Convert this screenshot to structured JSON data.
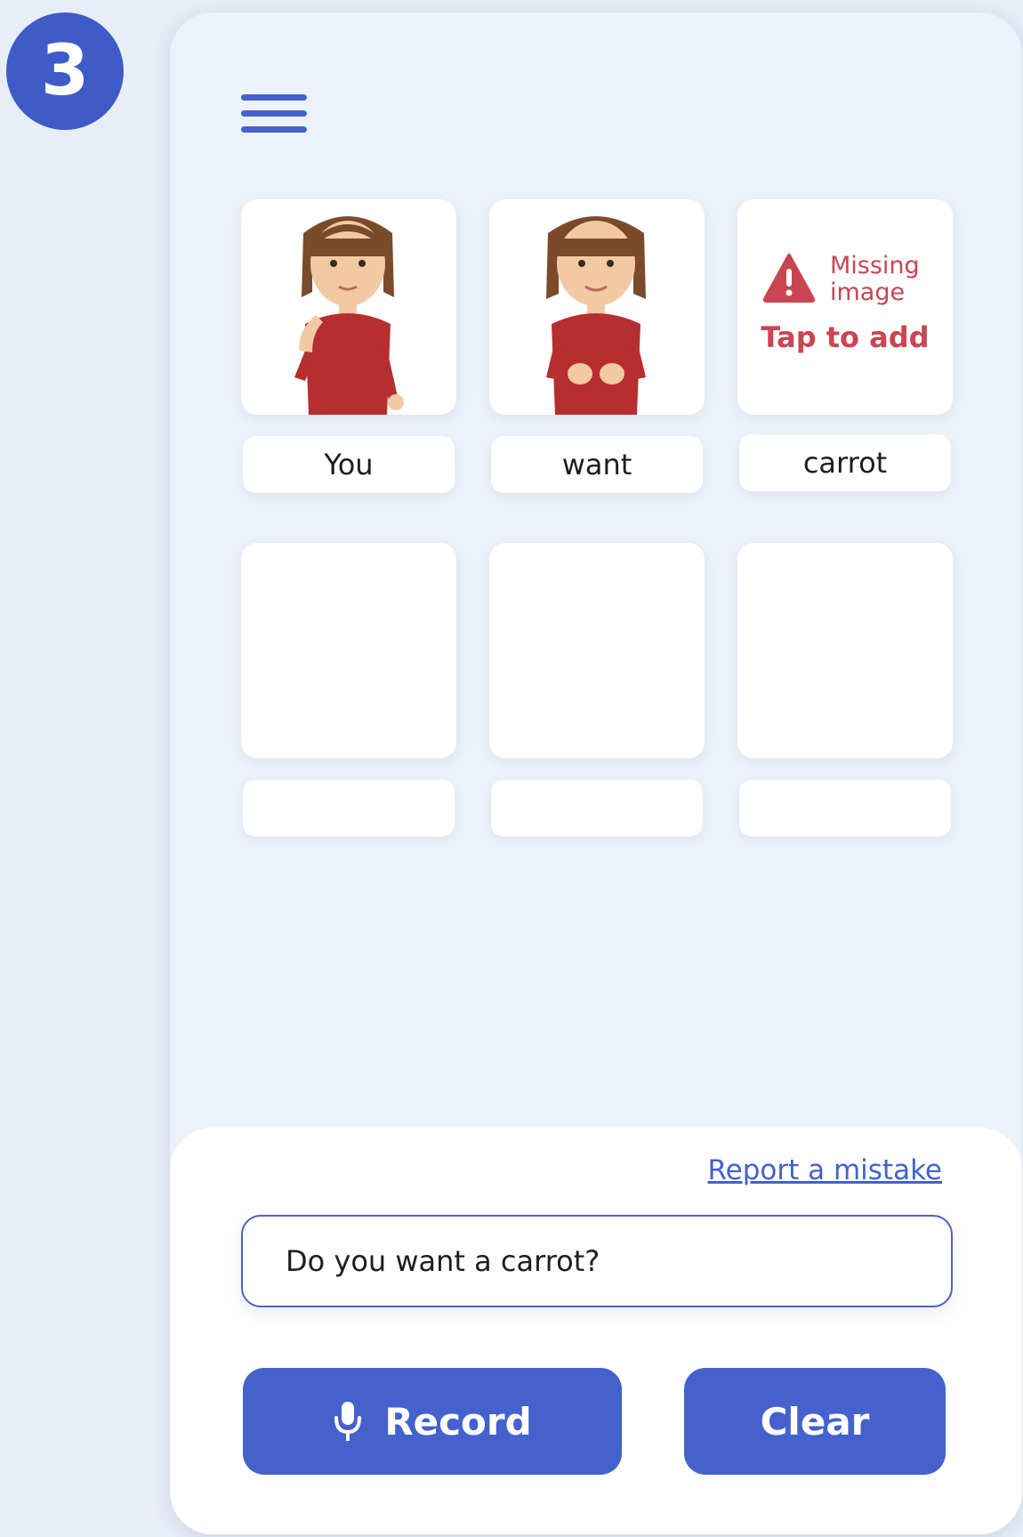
{
  "step_number": "3",
  "cards_row1": [
    {
      "label": "You",
      "image": "child-pointing-you-sign"
    },
    {
      "label": "want",
      "image": "child-want-sign"
    },
    {
      "label": "carrot",
      "image": null,
      "missing_title": "Missing image",
      "missing_action": "Tap to add"
    }
  ],
  "cards_row2": [
    {
      "label": ""
    },
    {
      "label": ""
    },
    {
      "label": ""
    }
  ],
  "bottom": {
    "report_link": "Report a mistake",
    "sentence_value": "Do you want a carrot?",
    "record_label": "Record",
    "clear_label": "Clear"
  },
  "colors": {
    "accent": "#4461cd",
    "warning": "#c94552",
    "background": "#edf2fa"
  }
}
